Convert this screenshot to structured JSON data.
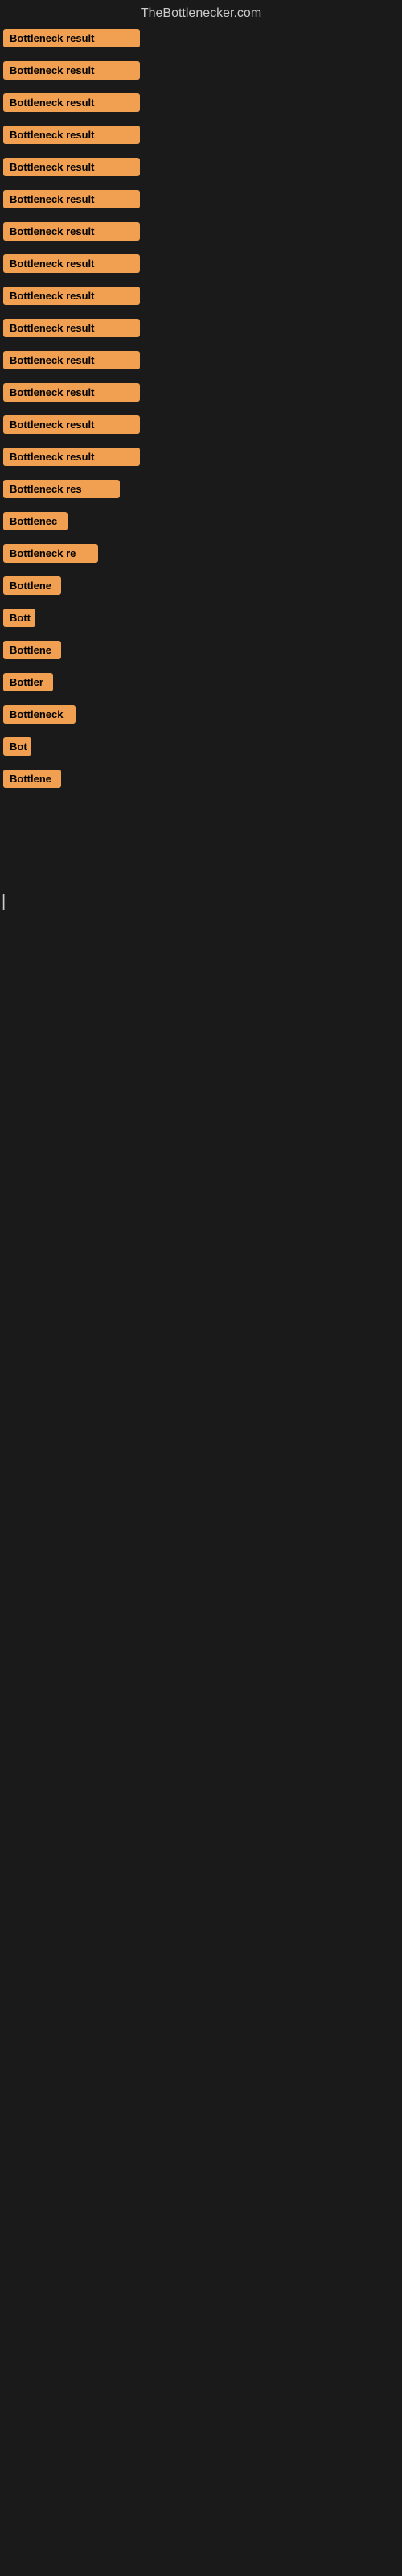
{
  "site": {
    "title": "TheBottlenecker.com"
  },
  "colors": {
    "badge_bg": "#f0a050",
    "badge_text": "#000000",
    "body_bg": "#1a1a1a",
    "site_title_color": "#cccccc"
  },
  "rows": [
    {
      "label": "Bottleneck result",
      "width": "full"
    },
    {
      "label": "Bottleneck result",
      "width": "full"
    },
    {
      "label": "Bottleneck result",
      "width": "full"
    },
    {
      "label": "Bottleneck result",
      "width": "full"
    },
    {
      "label": "Bottleneck result",
      "width": "full"
    },
    {
      "label": "Bottleneck result",
      "width": "full"
    },
    {
      "label": "Bottleneck result",
      "width": "full"
    },
    {
      "label": "Bottleneck result",
      "width": "full"
    },
    {
      "label": "Bottleneck result",
      "width": "full"
    },
    {
      "label": "Bottleneck result",
      "width": "full"
    },
    {
      "label": "Bottleneck result",
      "width": "full"
    },
    {
      "label": "Bottleneck result",
      "width": "full"
    },
    {
      "label": "Bottleneck result",
      "width": "full"
    },
    {
      "label": "Bottleneck result",
      "width": "full"
    },
    {
      "label": "Bottleneck res",
      "width": "partial1"
    },
    {
      "label": "Bottlenec",
      "width": "partial2"
    },
    {
      "label": "Bottleneck re",
      "width": "partial3"
    },
    {
      "label": "Bottlene",
      "width": "partial4"
    },
    {
      "label": "Bott",
      "width": "partial5"
    },
    {
      "label": "Bottlene",
      "width": "partial4"
    },
    {
      "label": "Bottler",
      "width": "partial6"
    },
    {
      "label": "Bottleneck",
      "width": "partial7"
    },
    {
      "label": "Bot",
      "width": "partial8"
    },
    {
      "label": "Bottlene",
      "width": "partial4"
    }
  ],
  "cursor": {
    "symbol": "|"
  }
}
